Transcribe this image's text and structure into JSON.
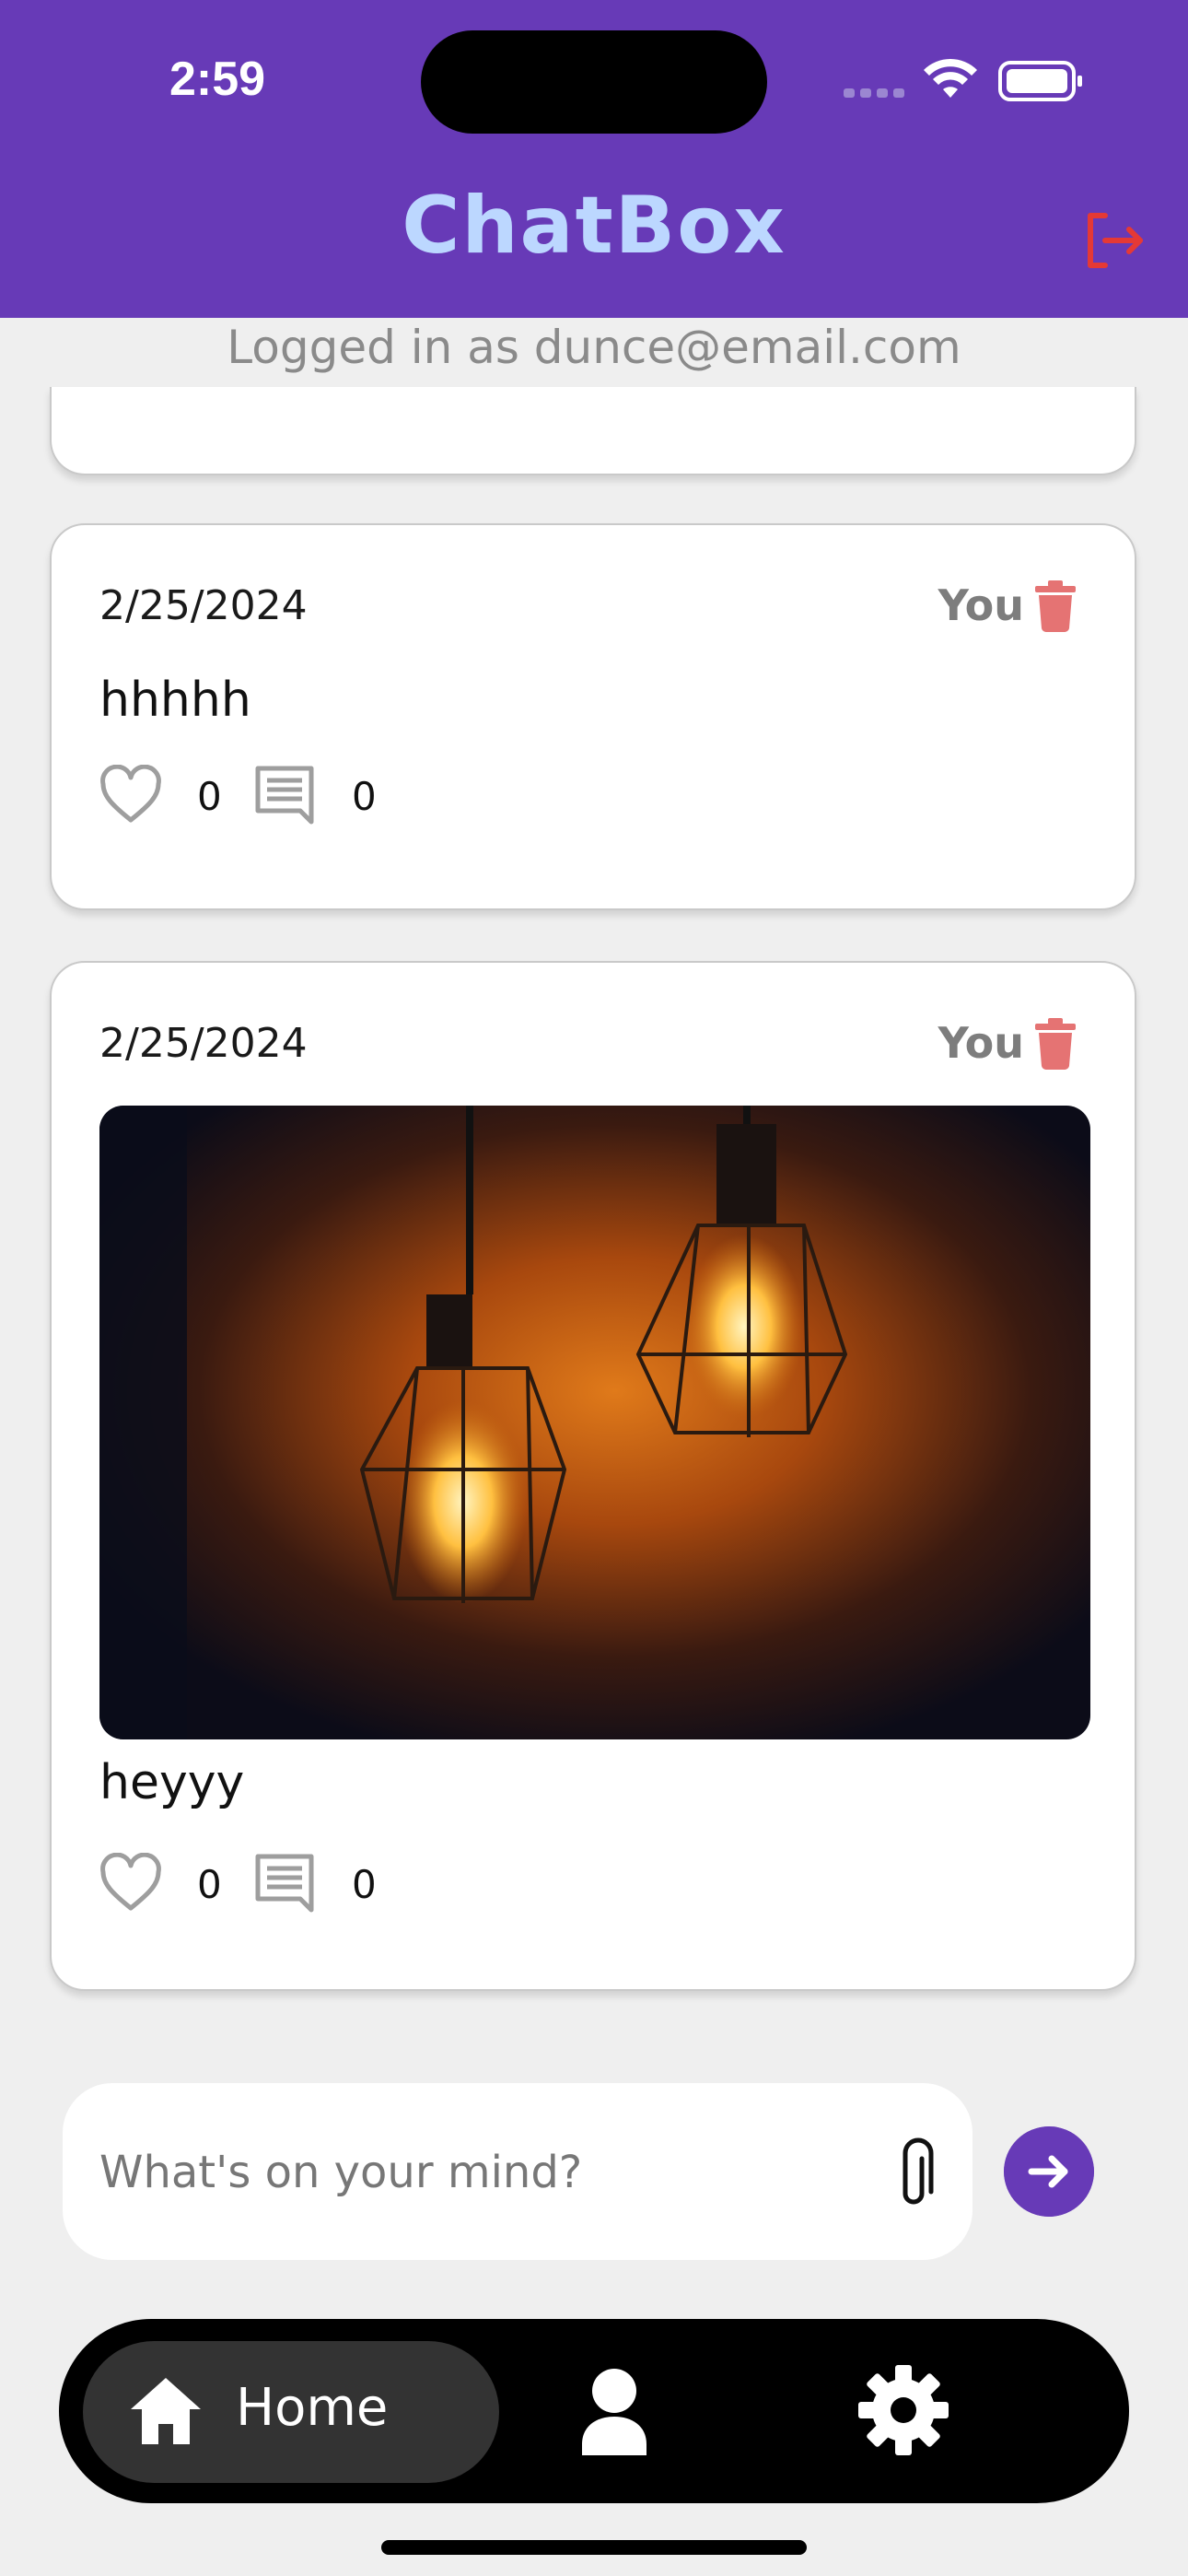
{
  "status_bar": {
    "time": "2:59"
  },
  "app": {
    "title": "ChatBox",
    "logged_in_text": "Logged in as dunce@email.com"
  },
  "posts": [
    {
      "date": "2/25/2024",
      "author": "You",
      "text": "hhhhh",
      "likes": "0",
      "comments": "0",
      "has_image": false
    },
    {
      "date": "2/25/2024",
      "author": "You",
      "text": "heyyy",
      "likes": "0",
      "comments": "0",
      "has_image": true,
      "image_subject": "two glowing pendant light bulbs in geometric cages"
    }
  ],
  "composer": {
    "placeholder": "What's on your mind?"
  },
  "nav": {
    "items": [
      {
        "label": "Home",
        "icon": "home-icon",
        "active": true
      },
      {
        "label": "",
        "icon": "profile-icon",
        "active": false
      },
      {
        "label": "",
        "icon": "gear-icon",
        "active": false
      }
    ]
  },
  "colors": {
    "header": "#673ab7",
    "title": "#bcd7ff",
    "logout": "#e53935",
    "trash": "#e57373",
    "send": "#673ab7",
    "nav": "#000000",
    "nav_active": "#333333"
  }
}
